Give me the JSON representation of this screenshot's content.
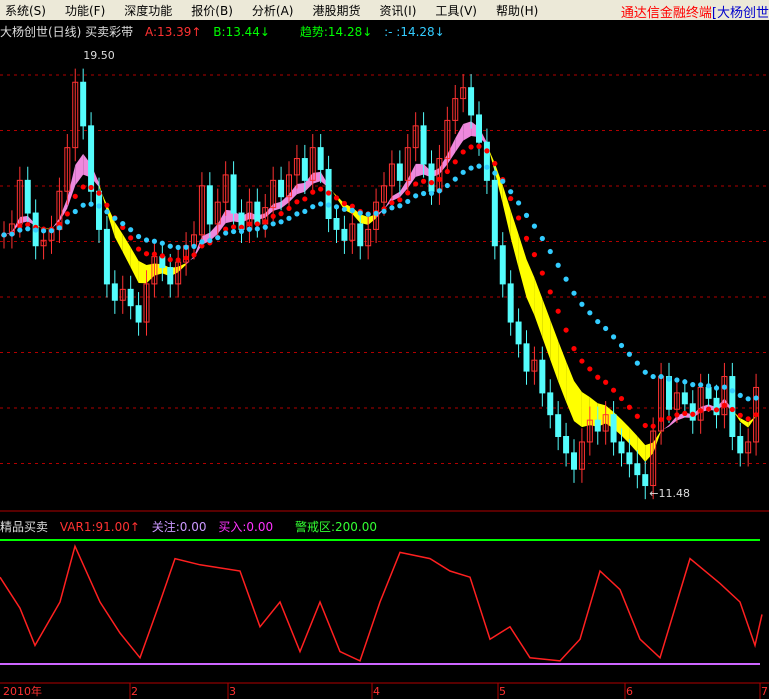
{
  "menu": [
    "系统(S)",
    "功能(F)",
    "深度功能",
    "报价(B)",
    "分析(A)",
    "港股期货",
    "资讯(I)",
    "工具(V)",
    "帮助(H)"
  ],
  "brand": "通达信金融终端",
  "brand_tail": "[大杨创世",
  "main_info": {
    "title": "大杨创世(日线) 买卖彩带",
    "a": "A:13.39↑",
    "b": "B:13.44↓",
    "trend": "趋势:14.28↓",
    "x": ":-  :14.28↓"
  },
  "sub_info": {
    "title": "精品买卖",
    "var1": "VAR1:91.00↑",
    "watch": "关注:0.00",
    "buy": "买入:0.00",
    "alert": "警戒区:200.00"
  },
  "colors": {
    "up": "#ff3232",
    "down": "#54fcfc",
    "grid": "#b00000",
    "ma_red": "#ff0000",
    "ma_cyan": "#33ccff",
    "band_yellow": "#ffff00",
    "band_pink": "#ee88dd"
  },
  "chart_data": {
    "type": "candlestick",
    "ylim": [
      11.0,
      20.0
    ],
    "high_label": "19.50",
    "low_label": "11.48",
    "x_ticks": [
      "2010年",
      "2",
      "3",
      "4",
      "5",
      "6",
      "7"
    ],
    "closes": [
      16.2,
      16.4,
      17.2,
      16.6,
      16.0,
      16.1,
      16.3,
      17.0,
      17.8,
      19.0,
      18.2,
      17.0,
      16.3,
      15.3,
      15.0,
      15.2,
      14.9,
      14.6,
      15.3,
      15.8,
      15.6,
      15.3,
      15.7,
      16.0,
      16.2,
      17.1,
      16.4,
      16.8,
      17.3,
      16.6,
      16.3,
      16.8,
      16.4,
      16.7,
      17.2,
      16.9,
      17.3,
      17.6,
      17.2,
      17.8,
      17.4,
      16.5,
      16.3,
      16.1,
      16.4,
      16.0,
      16.3,
      16.8,
      17.1,
      17.5,
      17.2,
      17.8,
      18.2,
      17.5,
      17.0,
      17.6,
      18.3,
      18.7,
      18.9,
      18.4,
      17.9,
      17.2,
      16.0,
      15.3,
      14.6,
      14.2,
      13.7,
      13.9,
      13.3,
      12.9,
      12.5,
      12.2,
      11.9,
      12.4,
      12.8,
      12.6,
      12.9,
      12.4,
      12.2,
      12.0,
      11.8,
      11.6,
      12.6,
      13.6,
      13.0,
      13.3,
      13.1,
      12.8,
      13.4,
      13.2,
      12.9,
      13.6,
      12.5,
      12.2,
      12.4,
      13.4
    ],
    "indicator": {
      "name": "VAR1",
      "ylim": [
        0,
        200
      ],
      "alert": 200,
      "points": [
        [
          0,
          140
        ],
        [
          20,
          90
        ],
        [
          35,
          30
        ],
        [
          60,
          100
        ],
        [
          75,
          190
        ],
        [
          100,
          100
        ],
        [
          120,
          50
        ],
        [
          140,
          10
        ],
        [
          160,
          100
        ],
        [
          175,
          170
        ],
        [
          200,
          160
        ],
        [
          240,
          150
        ],
        [
          260,
          60
        ],
        [
          280,
          100
        ],
        [
          300,
          20
        ],
        [
          320,
          100
        ],
        [
          340,
          20
        ],
        [
          360,
          5
        ],
        [
          380,
          100
        ],
        [
          400,
          180
        ],
        [
          430,
          170
        ],
        [
          450,
          150
        ],
        [
          470,
          140
        ],
        [
          490,
          40
        ],
        [
          510,
          60
        ],
        [
          530,
          10
        ],
        [
          560,
          5
        ],
        [
          580,
          40
        ],
        [
          600,
          150
        ],
        [
          620,
          120
        ],
        [
          640,
          40
        ],
        [
          660,
          10
        ],
        [
          690,
          170
        ],
        [
          720,
          130
        ],
        [
          740,
          100
        ],
        [
          755,
          30
        ],
        [
          762,
          80
        ]
      ]
    }
  }
}
